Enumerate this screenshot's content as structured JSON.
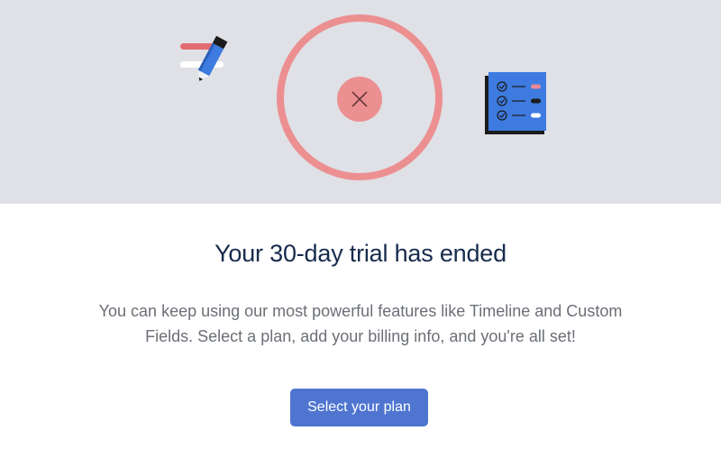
{
  "hero": {
    "illustration_icons": [
      "pencil-icon",
      "close-icon",
      "checklist-icon"
    ],
    "colors": {
      "background": "#dfe1e6",
      "ring": "#ec8f91",
      "pencil": "#3d7be0",
      "checklist": "#3d7be0"
    }
  },
  "dialog": {
    "title": "Your 30-day trial has ended",
    "body_line_1": "You can keep using our most powerful features like Timeline and Custom",
    "body_line_2": "Fields. Select a plan, add your billing info, and you're all set!",
    "cta_label": "Select your plan"
  },
  "colors": {
    "title_text": "#172b4d",
    "body_text": "#6b6f76",
    "button": "#4f75d1",
    "button_text": "#ffffff"
  }
}
